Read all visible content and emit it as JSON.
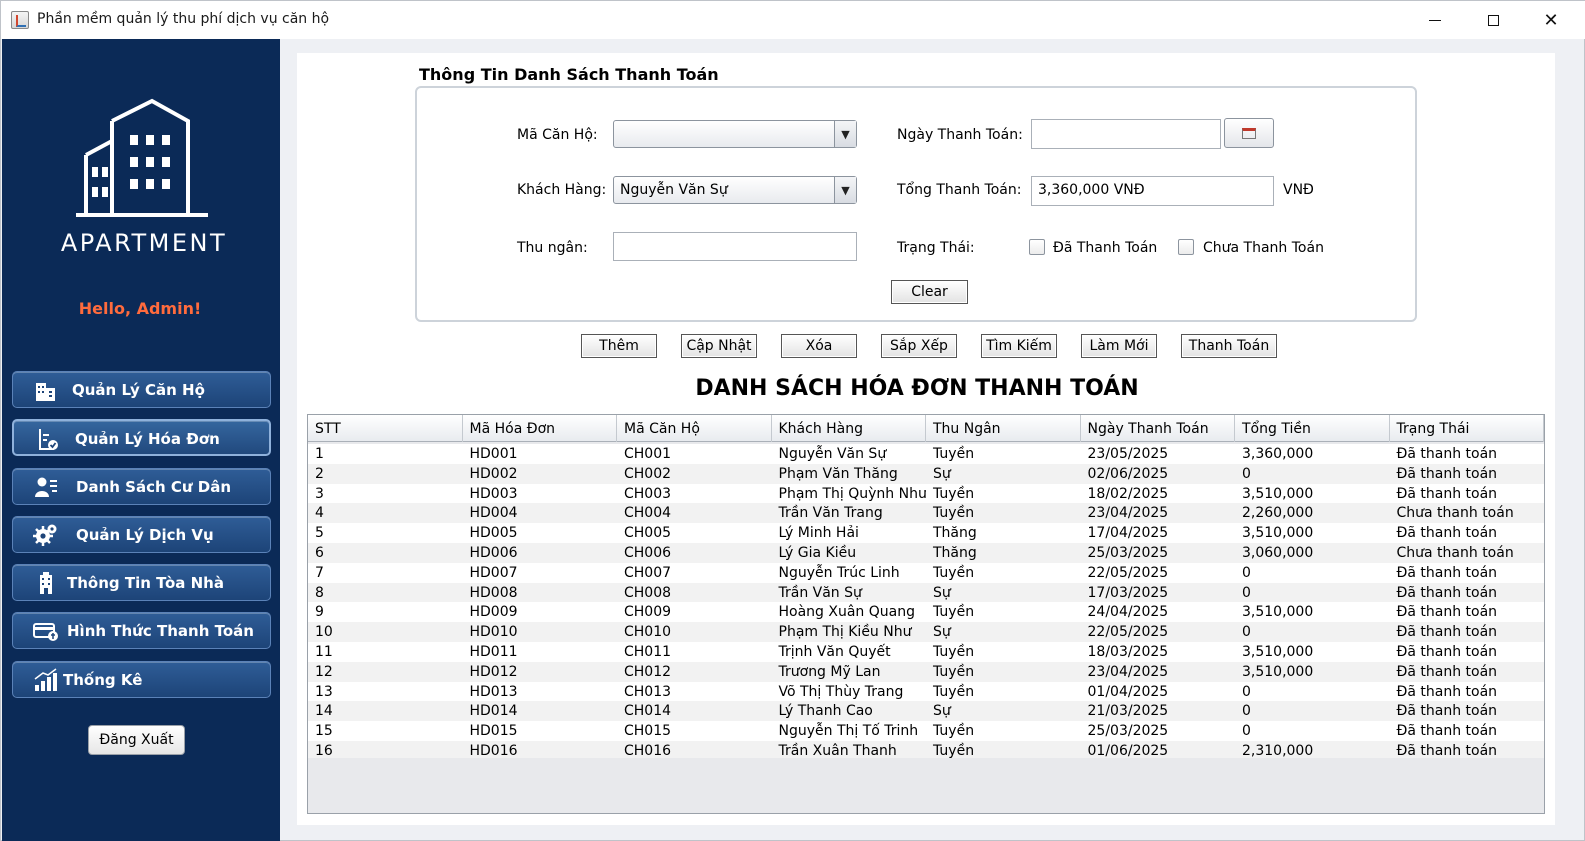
{
  "window": {
    "title": "Phần mềm quản lý thu phí dịch vụ căn hộ"
  },
  "sidebar": {
    "logo_text": "APARTMENT",
    "greeting": "Hello, Admin!",
    "items": [
      {
        "label": "Quản Lý Căn Hộ",
        "icon": "building-icon"
      },
      {
        "label": "Quản Lý Hóa Đơn",
        "icon": "invoice-icon"
      },
      {
        "label": "Danh Sách Cư Dân",
        "icon": "resident-list-icon"
      },
      {
        "label": "Quản Lý Dịch Vụ",
        "icon": "gears-icon"
      },
      {
        "label": "Thông Tin Tòa Nhà",
        "icon": "tower-icon"
      },
      {
        "label": "Hình Thức Thanh Toán",
        "icon": "payment-card-icon"
      },
      {
        "label": "Thống Kê",
        "icon": "bar-chart-icon"
      }
    ],
    "logout": "Đăng Xuất"
  },
  "form": {
    "section_title": "Thông Tin Danh Sách Thanh Toán",
    "ma_can_ho_label": "Mã Căn Hộ:",
    "ma_can_ho_value": "",
    "khach_hang_label": "Khách Hàng:",
    "khach_hang_value": "Nguyễn Văn Sự",
    "thu_ngan_label": "Thu ngân:",
    "thu_ngan_value": "",
    "ngay_thanh_toan_label": "Ngày Thanh Toán:",
    "ngay_thanh_toan_value": "",
    "tong_thanh_toan_label": "Tổng Thanh Toán:",
    "tong_thanh_toan_value": "3,360,000 VNĐ",
    "currency": "VNĐ",
    "trang_thai_label": "Trạng Thái:",
    "status_paid": "Đã Thanh Toán",
    "status_unpaid": "Chưa Thanh Toán",
    "clear": "Clear"
  },
  "actions": {
    "add": "Thêm",
    "update": "Cập Nhật",
    "delete": "Xóa",
    "sort": "Sắp Xếp",
    "search": "Tìm Kiếm",
    "refresh": "Làm Mới",
    "pay": "Thanh Toán"
  },
  "table": {
    "title": "DANH SÁCH HÓA ĐƠN THANH TOÁN",
    "columns": [
      "STT",
      "Mã Hóa Đơn",
      "Mã Căn Hộ",
      "Khách Hàng",
      "Thu Ngân",
      "Ngày Thanh Toán",
      "Tổng Tiền",
      "Trạng Thái"
    ],
    "rows": [
      [
        "1",
        "HD001",
        "CH001",
        "Nguyễn Văn Sự",
        "Tuyền",
        "23/05/2025",
        "3,360,000",
        "Đã thanh toán"
      ],
      [
        "2",
        "HD002",
        "CH002",
        "Phạm Văn Thăng",
        "Sự",
        "02/06/2025",
        "0",
        "Đã thanh toán"
      ],
      [
        "3",
        "HD003",
        "CH003",
        "Phạm Thị Quỳnh Như",
        "Tuyền",
        "18/02/2025",
        "3,510,000",
        "Đã thanh toán"
      ],
      [
        "4",
        "HD004",
        "CH004",
        "Trần Văn Trang",
        "Tuyền",
        "23/04/2025",
        "2,260,000",
        "Chưa thanh toán"
      ],
      [
        "5",
        "HD005",
        "CH005",
        "Lý Minh Hải",
        "Thăng",
        "17/04/2025",
        "3,510,000",
        "Đã thanh toán"
      ],
      [
        "6",
        "HD006",
        "CH006",
        "Lý Gia Kiều",
        "Thăng",
        "25/03/2025",
        "3,060,000",
        "Chưa thanh toán"
      ],
      [
        "7",
        "HD007",
        "CH007",
        "Nguyễn Trúc Linh",
        "Tuyền",
        "22/05/2025",
        "0",
        "Đã thanh toán"
      ],
      [
        "8",
        "HD008",
        "CH008",
        "Trần Văn Sự",
        "Sự",
        "17/03/2025",
        "0",
        "Đã thanh toán"
      ],
      [
        "9",
        "HD009",
        "CH009",
        "Hoàng Xuân Quang",
        "Tuyền",
        "24/04/2025",
        "3,510,000",
        "Đã thanh toán"
      ],
      [
        "10",
        "HD010",
        "CH010",
        "Phạm Thị Kiều Như",
        "Sự",
        "22/05/2025",
        "0",
        "Đã thanh toán"
      ],
      [
        "11",
        "HD011",
        "CH011",
        "Trịnh Văn Quyết",
        "Tuyền",
        "18/03/2025",
        "3,510,000",
        "Đã thanh toán"
      ],
      [
        "12",
        "HD012",
        "CH012",
        "Trương Mỹ Lan",
        "Tuyền",
        "23/04/2025",
        "3,510,000",
        "Đã thanh toán"
      ],
      [
        "13",
        "HD013",
        "CH013",
        "Võ Thị Thùy Trang",
        "Tuyền",
        "01/04/2025",
        "0",
        "Đã thanh toán"
      ],
      [
        "14",
        "HD014",
        "CH014",
        "Lý Thanh Cao",
        "Sự",
        "21/03/2025",
        "0",
        "Đã thanh toán"
      ],
      [
        "15",
        "HD015",
        "CH015",
        "Nguyễn Thị Tố Trinh",
        "Tuyền",
        "25/03/2025",
        "0",
        "Đã thanh toán"
      ],
      [
        "16",
        "HD016",
        "CH016",
        "Trần Xuân Thanh",
        "Tuyền",
        "01/06/2025",
        "2,310,000",
        "Đã thanh toán"
      ]
    ]
  }
}
